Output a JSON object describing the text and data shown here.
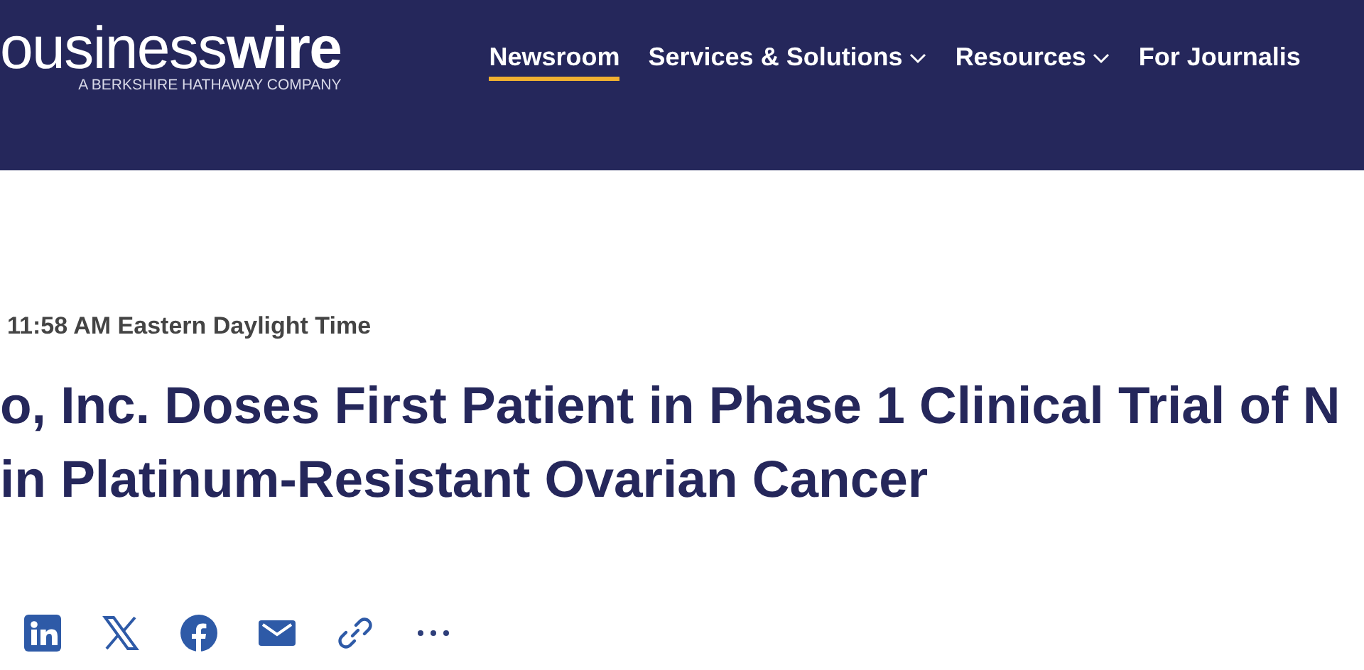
{
  "header": {
    "logo": "ousiness**wire**",
    "tagline": "A BERKSHIRE HATHAWAY COMPANY",
    "nav": [
      {
        "label": "Newsroom",
        "selected": true,
        "dropdown": false
      },
      {
        "label": "Services & Solutions",
        "selected": false,
        "dropdown": true
      },
      {
        "label": "Resources",
        "selected": false,
        "dropdown": true
      },
      {
        "label": "For Journalis",
        "selected": false,
        "dropdown": false
      }
    ]
  },
  "article": {
    "timestamp": "11:58 AM Eastern Daylight Time",
    "title_lines": [
      "o, Inc. Doses First Patient in Phase 1 Clinical Trial of N",
      "in Platinum-Resistant Ovarian Cancer"
    ],
    "share": [
      {
        "kind": "linkedin"
      },
      {
        "kind": "x"
      },
      {
        "kind": "facebook"
      },
      {
        "kind": "email"
      },
      {
        "kind": "link"
      },
      {
        "kind": "more"
      }
    ]
  }
}
